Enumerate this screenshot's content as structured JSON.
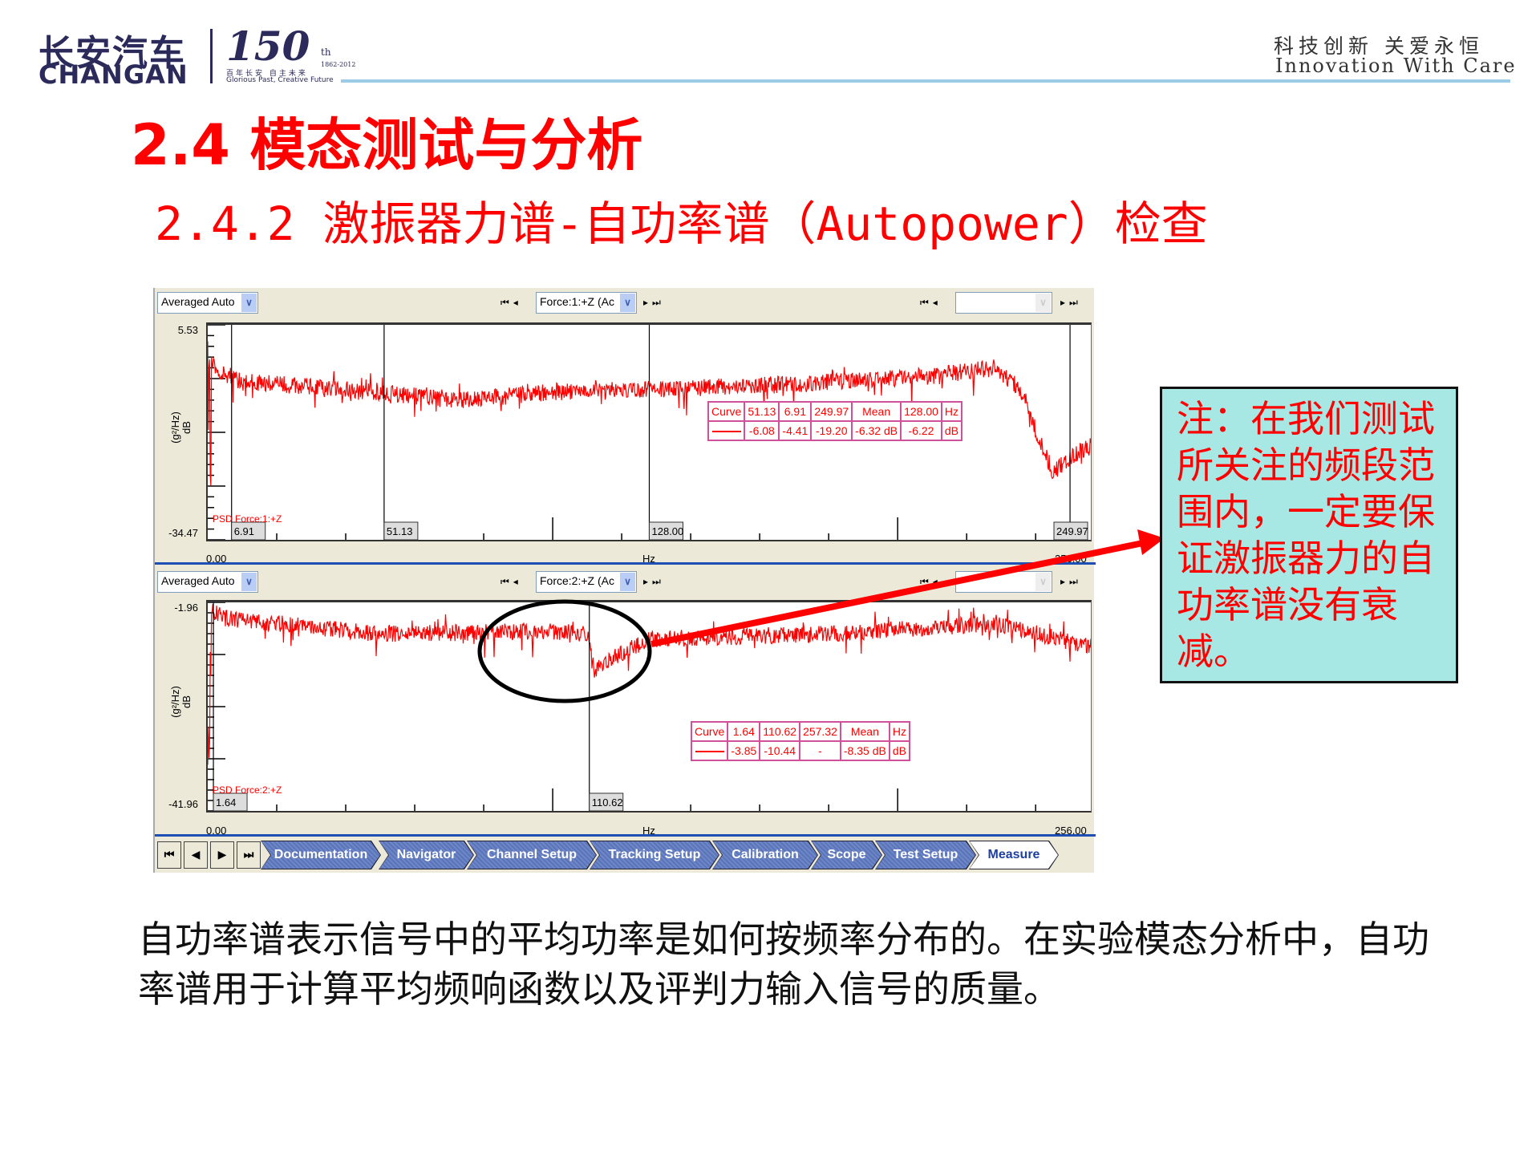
{
  "header": {
    "logo_cn": "长安汽车",
    "logo_en": "CHANGAN",
    "anniv": "150",
    "anniv_suffix": "th",
    "anniv_years": "1862-2012",
    "anniv_cn": "百年长安 自主未来",
    "anniv_en": "Glorious Past, Creative Future",
    "slogan_cn": "科技创新  关爱永恒",
    "slogan_en": "Innovation With Care"
  },
  "title": "2.4 模态测试与分析",
  "subtitle": "2.4.2 激振器力谱-自功率谱（Autopower）检查",
  "colors": {
    "title": "#ff0000",
    "trace": "#ff0000",
    "note_bg": "#a8e8e4",
    "tab": "#5b74b8",
    "header_line": "#9ccbe6"
  },
  "panels": [
    {
      "mode": "Averaged Auto",
      "channel": "Force:1:+Z (Ac",
      "ymax": "5.53",
      "ymin": "-34.47",
      "ymax_v": 5.53,
      "ymin_v": -34.47,
      "xmin": "0.00",
      "xmax": "256.00",
      "xunit": "Hz",
      "yunit_top": "(g²/Hz)",
      "yunit_bottom": "dB",
      "trace_label": "PSD Force:1:+Z",
      "cursors": [
        "6.91",
        "51.13",
        "128.00",
        "249.97"
      ],
      "legend": {
        "header": [
          "Curve",
          "51.13",
          "6.91",
          "249.97",
          "Mean",
          "128.00",
          "Hz"
        ],
        "values": [
          "-6.08",
          "-4.41",
          "-19.20",
          "-6.32 dB",
          "-6.22",
          "dB"
        ]
      },
      "trace_points": [
        [
          0,
          -1
        ],
        [
          3,
          -3
        ],
        [
          10,
          -5
        ],
        [
          40,
          -6.5
        ],
        [
          72,
          -8.5
        ],
        [
          100,
          -7
        ],
        [
          128,
          -6.5
        ],
        [
          170,
          -5.5
        ],
        [
          210,
          -4
        ],
        [
          228,
          -2.5
        ],
        [
          235,
          -6
        ],
        [
          245,
          -22
        ],
        [
          250,
          -19
        ],
        [
          256,
          -17
        ]
      ]
    },
    {
      "mode": "Averaged Auto",
      "channel": "Force:2:+Z (Ac",
      "ymax": "-1.96",
      "ymin": "-41.96",
      "ymax_v": -1.96,
      "ymin_v": -41.96,
      "xmin": "0.00",
      "xmax": "256.00",
      "xunit": "Hz",
      "yunit_top": "(g²/Hz)",
      "yunit_bottom": "dB",
      "trace_label": "PSD Force:2:+Z",
      "cursors": [
        "1.64",
        "110.62"
      ],
      "legend": {
        "header": [
          "Curve",
          "1.64",
          "110.62",
          "257.32",
          "Mean",
          "Hz"
        ],
        "values": [
          "-3.85",
          "-10.44",
          "-",
          "-8.35 dB",
          "dB"
        ]
      },
      "trace_points": [
        [
          0,
          -3
        ],
        [
          5,
          -5
        ],
        [
          50,
          -8
        ],
        [
          100,
          -7.5
        ],
        [
          110,
          -8
        ],
        [
          112,
          -15
        ],
        [
          118,
          -12.5
        ],
        [
          128,
          -9
        ],
        [
          180,
          -8
        ],
        [
          228,
          -6
        ],
        [
          256,
          -10.5
        ]
      ]
    }
  ],
  "tabs": [
    "Documentation",
    "Navigator",
    "Channel Setup",
    "Tracking Setup",
    "Calibration",
    "Scope",
    "Test Setup",
    "Measure"
  ],
  "active_tab": "Measure",
  "note": "注：在我们测试所关注的频段范围内，一定要保证激振器力的自功率谱没有衰减。",
  "body_text": "自功率谱表示信号中的平均功率是如何按频率分布的。在实验模态分析中，自功率谱用于计算平均频响函数以及评判力输入信号的质量。"
}
